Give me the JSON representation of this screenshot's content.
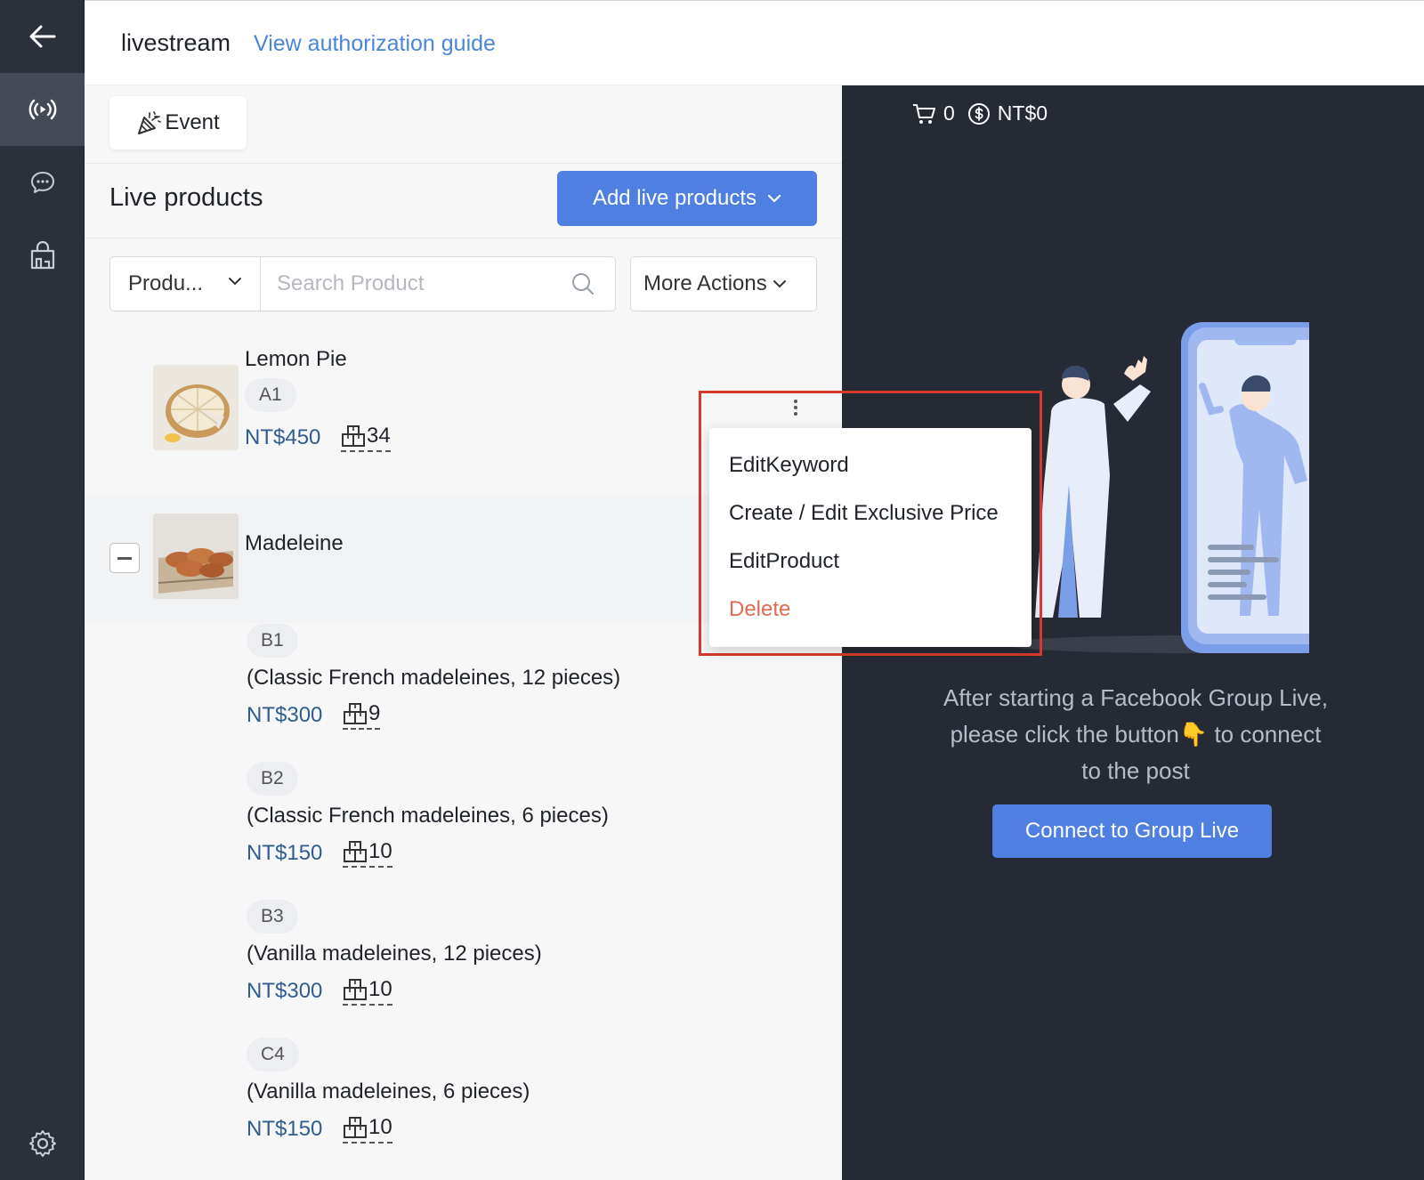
{
  "header": {
    "title": "livestream",
    "guide_link": "View authorization guide"
  },
  "sidebar": {
    "items": [
      {
        "icon": "back-arrow-icon"
      },
      {
        "icon": "broadcast-icon",
        "active": true
      },
      {
        "icon": "chat-bubble-icon"
      },
      {
        "icon": "shop-bag-icon"
      },
      {
        "icon": "gear-icon"
      }
    ]
  },
  "event_button": {
    "label": "Event",
    "icon": "party-popper-icon"
  },
  "products_section": {
    "title": "Live products",
    "add_button": "Add live products"
  },
  "filter": {
    "select_value": "Produ...",
    "search_placeholder": "Search Product",
    "more_actions": "More Actions"
  },
  "products": [
    {
      "name": "Lemon Pie",
      "code": "A1",
      "price": "NT$450",
      "stock": "34"
    },
    {
      "name": "Madeleine",
      "variants": [
        {
          "code": "B1",
          "desc": "(Classic French madeleines, 12 pieces)",
          "price": "NT$300",
          "stock": "9"
        },
        {
          "code": "B2",
          "desc": "(Classic French madeleines, 6 pieces)",
          "price": "NT$150",
          "stock": "10"
        },
        {
          "code": "B3",
          "desc": "(Vanilla madeleines, 12 pieces)",
          "price": "NT$300",
          "stock": "10"
        },
        {
          "code": "C4",
          "desc": "(Vanilla madeleines, 6 pieces)",
          "price": "NT$150",
          "stock": "10"
        }
      ]
    }
  ],
  "context_menu": {
    "items": [
      "EditKeyword",
      "Create / Edit Exclusive Price",
      "EditProduct",
      "Delete"
    ]
  },
  "live_panel": {
    "cart_count": "0",
    "revenue": "NT$0",
    "line1": "After starting a Facebook Group Live,",
    "line2_before": "please click the button",
    "line2_emoji": "👇",
    "line2_after": " to connect",
    "line3": "to the post",
    "connect_button": "Connect to Group Live"
  },
  "colors": {
    "accent": "#4f7fe0",
    "link": "#4a86d8",
    "price": "#2f5d8f",
    "danger": "#e26a53",
    "sidebar_bg": "#2b303b",
    "dark_panel": "#262a35",
    "highlight": "#d83a2a"
  }
}
